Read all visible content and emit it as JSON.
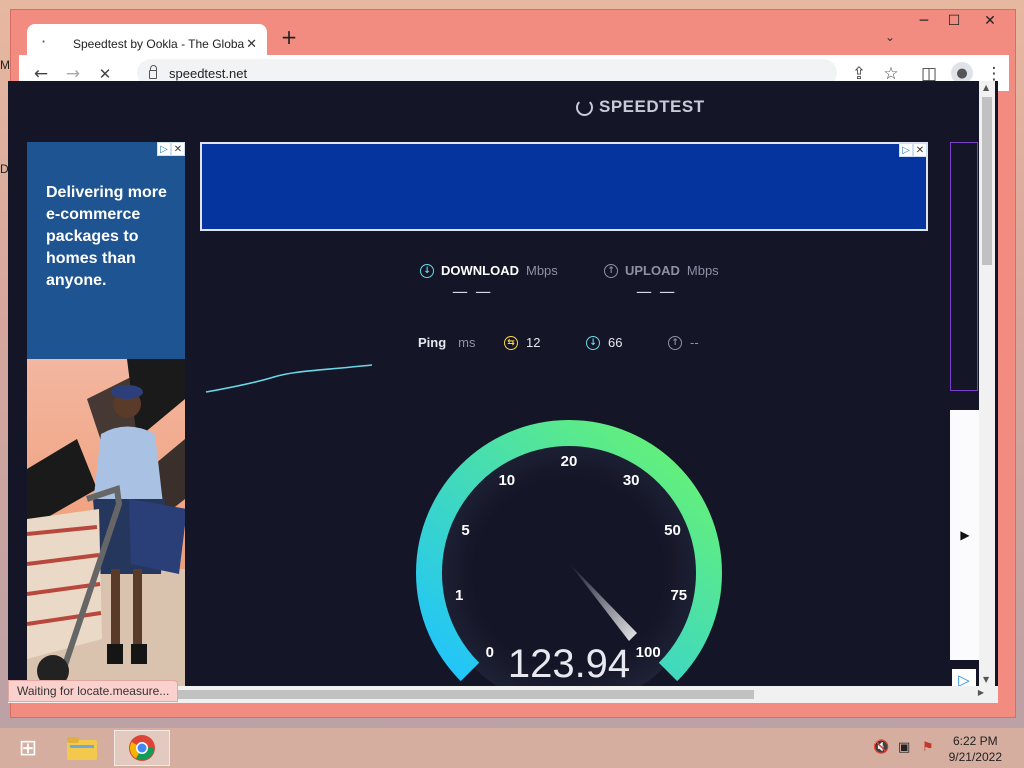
{
  "desktop": {
    "frag_top": "M",
    "frag_mid": "D"
  },
  "window": {
    "minimize": "─",
    "maximize": "☐",
    "close": "✕"
  },
  "tabs": [
    {
      "title": "Speedtest by Ookla - The Global",
      "close": "✕",
      "favicon": "loading-dots-icon"
    }
  ],
  "new_tab": "+",
  "tab_search": "⌄",
  "toolbar": {
    "back": "←",
    "forward": "→",
    "reload": "✕",
    "url": "speedtest.net",
    "share": "⇪",
    "star": "☆",
    "sidebar": "◫",
    "menu": "⋮"
  },
  "page": {
    "brand": "SPEEDTEST",
    "ad_left": {
      "text": "Delivering more e-commerce packages to homes than anyone."
    },
    "download": {
      "label": "DOWNLOAD",
      "unit": "Mbps",
      "value": "— —"
    },
    "upload": {
      "label": "UPLOAD",
      "unit": "Mbps",
      "value": "— —"
    },
    "ping": {
      "label": "Ping",
      "unit": "ms",
      "idle": "12",
      "download": "66",
      "upload": "--"
    },
    "gauge": {
      "ticks": [
        "0",
        "1",
        "5",
        "10",
        "20",
        "30",
        "50",
        "75",
        "100"
      ],
      "reading": "123.94",
      "colors": {
        "start": "#1ec3ff",
        "end": "#6cf56a"
      }
    },
    "status": "Waiting for locate.measure..."
  },
  "taskbar": {
    "start": "⊞",
    "time": "6:22 PM",
    "date": "9/21/2022"
  }
}
